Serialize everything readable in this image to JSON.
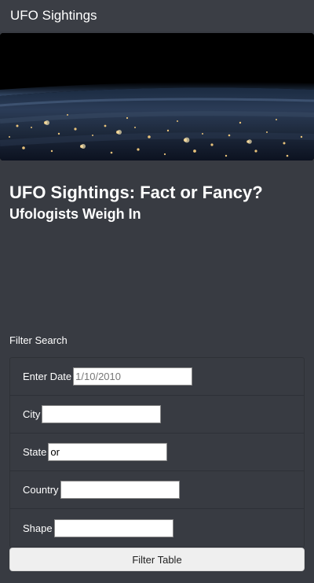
{
  "navbar": {
    "brand": "UFO Sightings"
  },
  "hero": {
    "image": "earth-night-city-lights"
  },
  "main": {
    "title": "UFO Sightings: Fact or Fancy?",
    "subtitle": "Ufologists Weigh In"
  },
  "filters": {
    "heading": "Filter Search",
    "date": {
      "label": "Enter Date",
      "value": "",
      "placeholder": "1/10/2010"
    },
    "city": {
      "label": "City",
      "value": "",
      "placeholder": ""
    },
    "state": {
      "label": "State",
      "value": "or",
      "placeholder": ""
    },
    "country": {
      "label": "Country",
      "value": "",
      "placeholder": ""
    },
    "shape": {
      "label": "Shape",
      "value": "",
      "placeholder": ""
    },
    "button_label": "Filter Table"
  },
  "colors": {
    "page_background": "#383b42",
    "navbar_background": "#3b3e45",
    "text": "#ffffff",
    "button_background": "#efefef"
  }
}
